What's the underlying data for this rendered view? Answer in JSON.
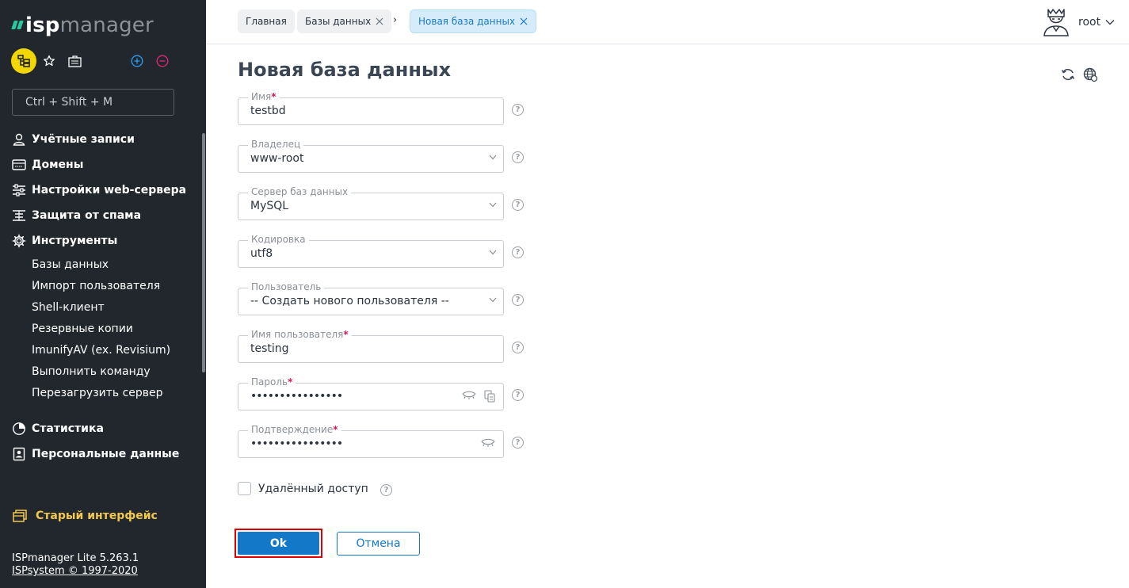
{
  "app": {
    "logo_isp": "isp",
    "logo_manager": "manager"
  },
  "sidebar": {
    "search_placeholder": "Ctrl + Shift + M",
    "nav": [
      {
        "label": "Учётные записи",
        "icon": "users-icon"
      },
      {
        "label": "Домены",
        "icon": "domain-icon"
      },
      {
        "label": "Настройки web-сервера",
        "icon": "sliders-icon"
      },
      {
        "label": "Защита от спама",
        "icon": "spam-filter-icon"
      },
      {
        "label": "Инструменты",
        "icon": "gear-icon"
      }
    ],
    "tools_sub": [
      "Базы данных",
      "Импорт пользователя",
      "Shell-клиент",
      "Резервные копии",
      "ImunifyAV (ex. Revisium)",
      "Выполнить команду",
      "Перезагрузить сервер"
    ],
    "nav2": [
      {
        "label": "Статистика",
        "icon": "pie-chart-icon"
      },
      {
        "label": "Персональные данные",
        "icon": "personal-data-icon"
      }
    ],
    "old_interface": "Старый интерфейс",
    "footer_version": "ISPmanager Lite 5.263.1",
    "footer_copyright": "ISPsystem © 1997-2020"
  },
  "header": {
    "breadcrumbs": [
      {
        "label": "Главная"
      },
      {
        "label": "Базы данных"
      },
      {
        "label": "Новая база данных"
      }
    ],
    "separator": "›",
    "username": "root"
  },
  "form": {
    "title": "Новая база данных",
    "fields": [
      {
        "label": "Имя",
        "required": true,
        "value": "testbd",
        "type": "text"
      },
      {
        "label": "Владелец",
        "required": false,
        "value": "www-root",
        "type": "select"
      },
      {
        "label": "Сервер баз данных",
        "required": false,
        "value": "MySQL",
        "type": "select"
      },
      {
        "label": "Кодировка",
        "required": false,
        "value": "utf8",
        "type": "select"
      },
      {
        "label": "Пользователь",
        "required": false,
        "value": "-- Создать нового пользователя --",
        "type": "select"
      },
      {
        "label": "Имя пользователя",
        "required": true,
        "value": "testing",
        "type": "text"
      },
      {
        "label": "Пароль",
        "required": true,
        "value": "••••••••••••••••",
        "type": "password"
      },
      {
        "label": "Подтверждение",
        "required": true,
        "value": "••••••••••••••••",
        "type": "password"
      }
    ],
    "remote_access_label": "Удалённый доступ",
    "help_glyph": "?",
    "required_mark": "*",
    "ok_label": "Ok",
    "cancel_label": "Отмена"
  },
  "colors": {
    "accent": "#1478c8",
    "sidebar_bg": "#22272d",
    "highlight": "#e00000",
    "brand_yellow": "#f2d600",
    "logo_green": "#27c9a0"
  }
}
